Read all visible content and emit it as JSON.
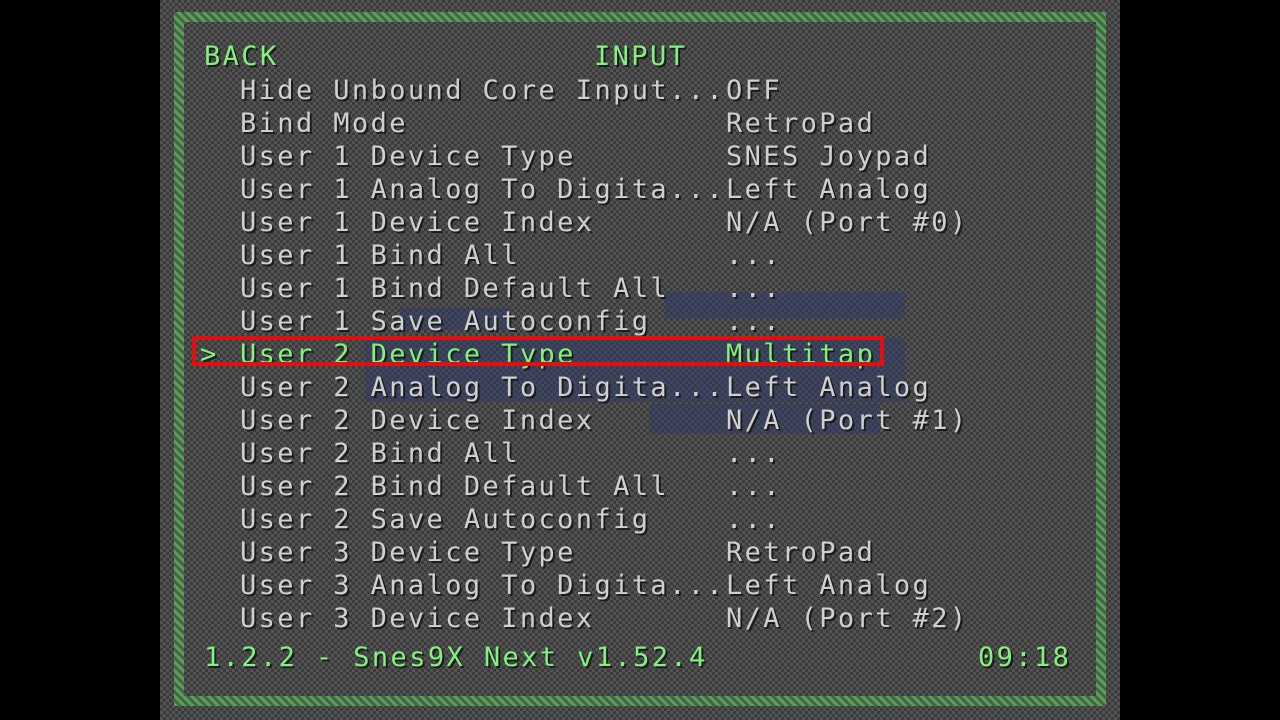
{
  "header": {
    "back_label": "BACK",
    "title": "INPUT"
  },
  "menu": {
    "selected_index": 8,
    "cursor_glyph": ">",
    "items": [
      {
        "label": "Hide Unbound Core Input...",
        "value": "OFF"
      },
      {
        "label": "Bind Mode",
        "value": "RetroPad"
      },
      {
        "label": "User 1 Device Type",
        "value": "SNES Joypad"
      },
      {
        "label": "User 1 Analog To Digita...",
        "value": "Left Analog"
      },
      {
        "label": "User 1 Device Index",
        "value": "N/A (Port #0)"
      },
      {
        "label": "User 1 Bind All",
        "value": "..."
      },
      {
        "label": "User 1 Bind Default All",
        "value": "..."
      },
      {
        "label": "User 1 Save Autoconfig",
        "value": "..."
      },
      {
        "label": "User 2 Device Type",
        "value": "Multitap"
      },
      {
        "label": "User 2 Analog To Digita...",
        "value": "Left Analog"
      },
      {
        "label": "User 2 Device Index",
        "value": "N/A (Port #1)"
      },
      {
        "label": "User 2 Bind All",
        "value": "..."
      },
      {
        "label": "User 2 Bind Default All",
        "value": "..."
      },
      {
        "label": "User 2 Save Autoconfig",
        "value": "..."
      },
      {
        "label": "User 3 Device Type",
        "value": "RetroPad"
      },
      {
        "label": "User 3 Analog To Digita...",
        "value": "Left Analog"
      },
      {
        "label": "User 3 Device Index",
        "value": "N/A (Port #2)"
      }
    ]
  },
  "footer": {
    "core_info": "1.2.2 - Snes9X Next v1.52.4",
    "clock": "09:18"
  },
  "colors": {
    "accent_green": "#82f27e",
    "text_normal": "#d0d0d0",
    "highlight_red": "#e01010",
    "frame_green": "#5f9a5f",
    "background": "#474747"
  }
}
